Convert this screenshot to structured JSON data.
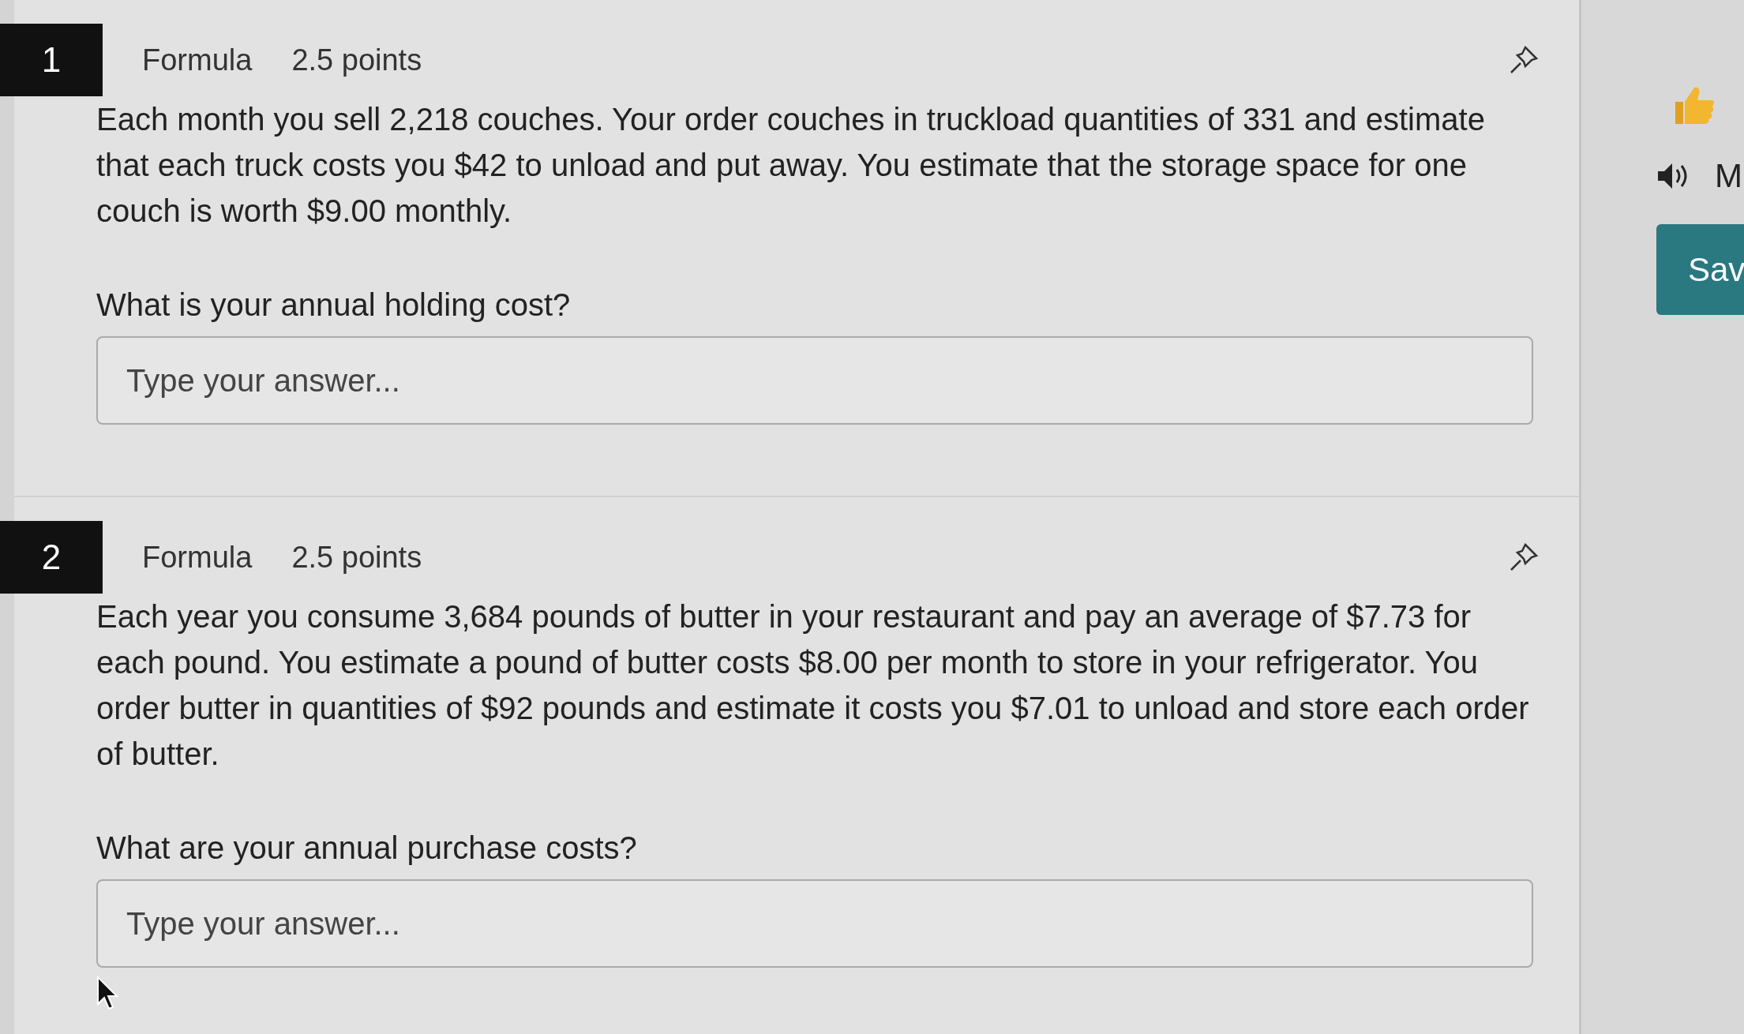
{
  "questions": [
    {
      "number": "1",
      "type": "Formula",
      "points": "2.5 points",
      "text": "Each month you sell 2,218 couches. Your order couches in truckload quantities of 331 and estimate that each truck costs you $42 to unload and put away. You estimate that the storage space for one couch is worth $9.00 monthly.",
      "prompt": "What is your annual holding cost?",
      "answer": {
        "placeholder": "Type your answer..."
      }
    },
    {
      "number": "2",
      "type": "Formula",
      "points": "2.5 points",
      "text": "Each year you consume 3,684 pounds of butter in your restaurant and pay an average of $7.73 for each pound. You estimate a pound of butter costs $8.00 per month to store in your refrigerator. You order butter in quantities of $92 pounds and estimate it costs you $7.01 to unload and store each order of butter.",
      "prompt": "What are your annual purchase costs?",
      "answer": {
        "placeholder": "Type your answer..."
      }
    }
  ],
  "sidebar": {
    "label": "M",
    "button": "Sav"
  }
}
